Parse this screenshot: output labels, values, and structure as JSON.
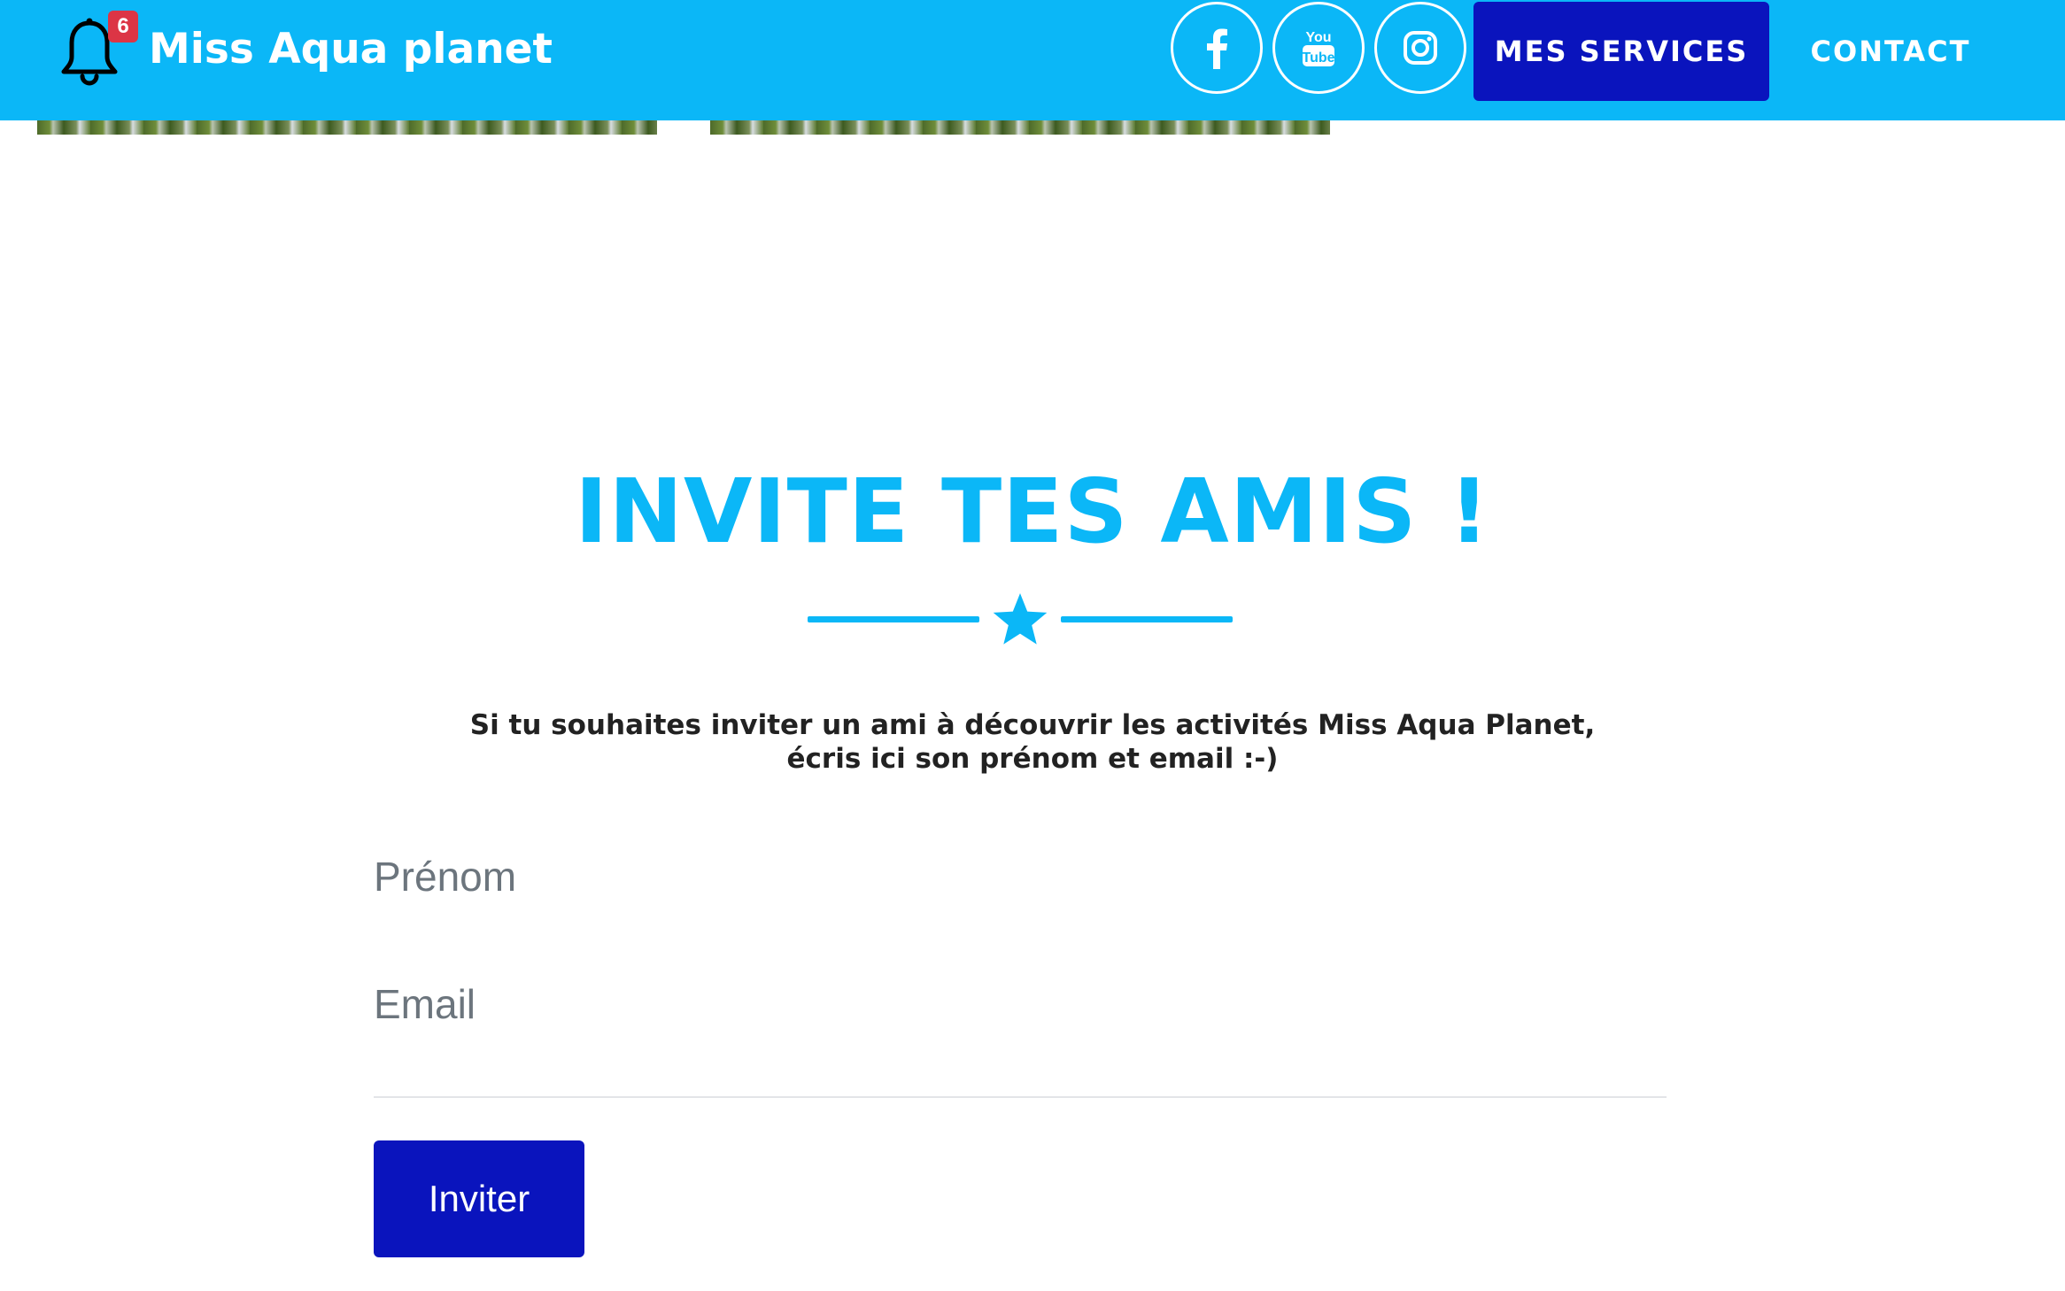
{
  "header": {
    "notification_count": "6",
    "brand": "Miss Aqua planet",
    "social": [
      {
        "icon": "facebook-icon"
      },
      {
        "icon": "youtube-icon"
      },
      {
        "icon": "instagram-icon"
      }
    ],
    "services_label": "MES SERVICES",
    "contact_label": "CONTACT"
  },
  "section": {
    "title": "INVITE TES AMIS !",
    "intro_line1": "Si tu souhaites inviter un ami à découvrir les activités Miss Aqua Planet,",
    "intro_line2": "écris ici son prénom et email :-)"
  },
  "form": {
    "prenom_placeholder": "Prénom",
    "prenom_value": "",
    "email_placeholder": "Email",
    "email_value": "",
    "submit_label": "Inviter"
  },
  "colors": {
    "primary": "#0bb7f7",
    "button": "#0a14bd",
    "badge": "#dc3545"
  }
}
